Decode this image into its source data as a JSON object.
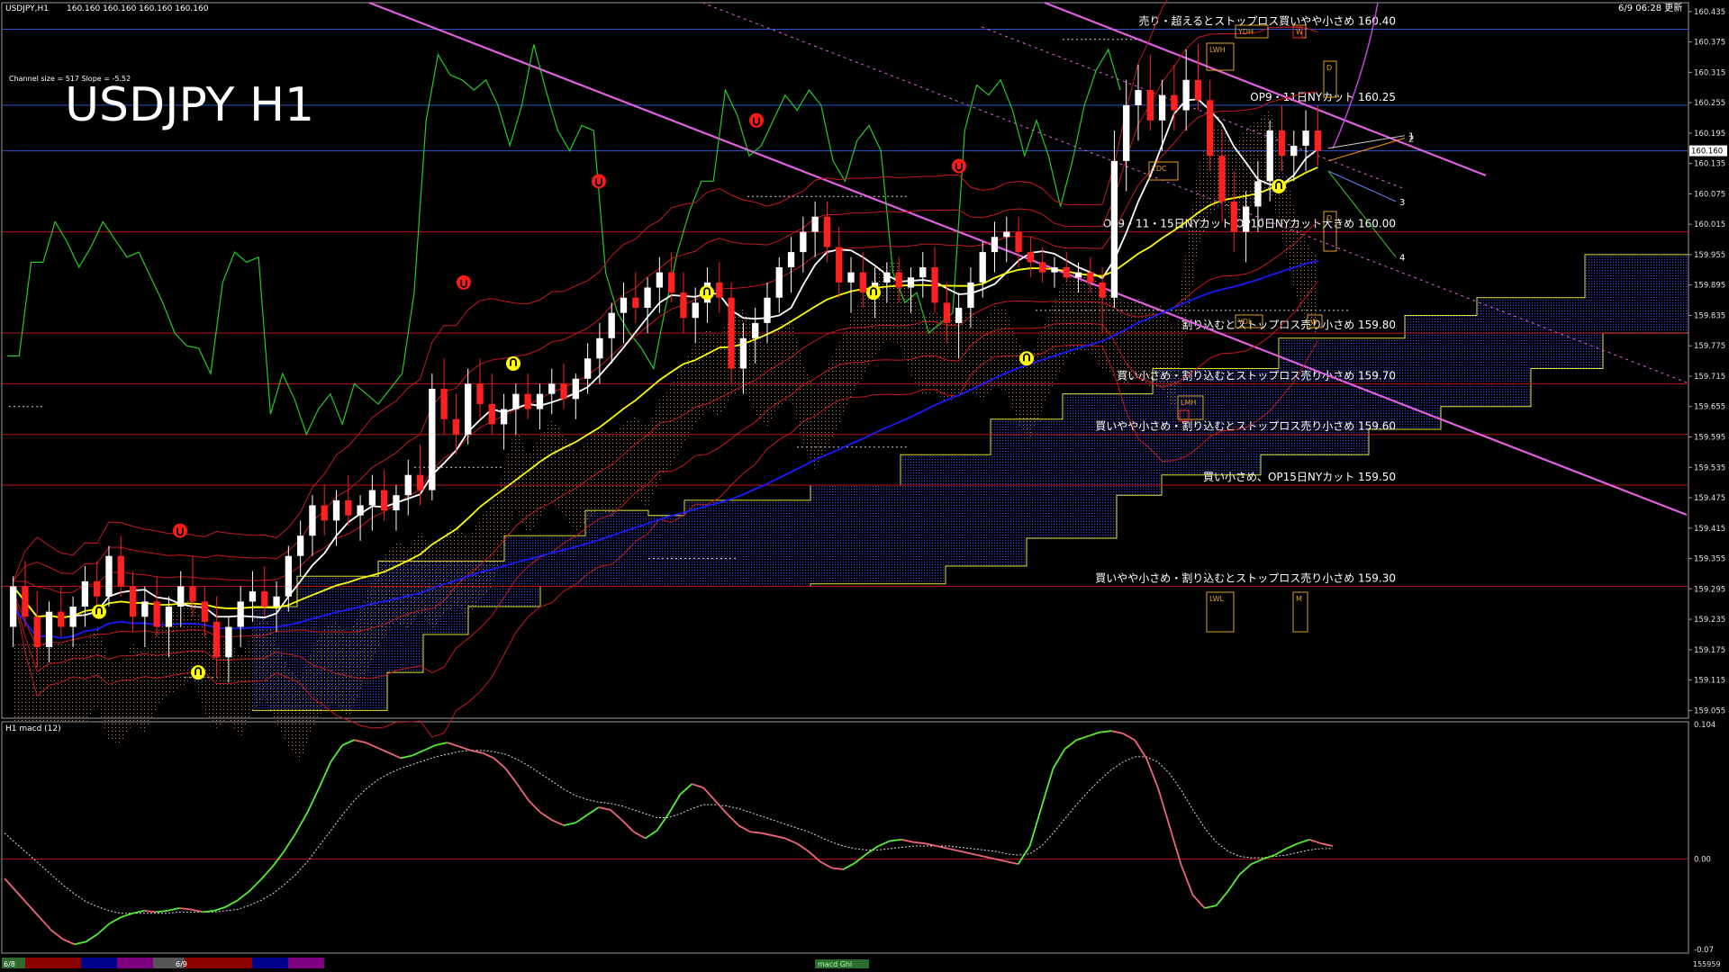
{
  "window": {
    "header_symbol": "USDJPY,H1",
    "header_ohlc": "160.160 160.160 160.160 160.160",
    "datetime": "6/9 06:28 更新"
  },
  "main_panel": {
    "title": "USDJPY H1",
    "channel_info": "Channel size = 517 Slope = -5.52",
    "price_tag": "160.160"
  },
  "macd_panel": {
    "title": "H1 macd (12)",
    "legend": "macd Ghl",
    "bottom_value": "155959"
  },
  "bottom_bar": {
    "date_labels": [
      "6/8",
      "6/9"
    ],
    "colors": [
      "#8b0000",
      "#00008b",
      "#7f007f",
      "#555555",
      "#8b0000",
      "#00008b",
      "#7f007f"
    ]
  },
  "order_levels": [
    {
      "price": 160.4,
      "label": "売り・超えるとストップロス買いやや小さめ 160.40",
      "line_color": "#2b55c9"
    },
    {
      "price": 160.25,
      "label": "OP9・11日NYカット 160.25",
      "line_color": "#2b55c9"
    },
    {
      "price": 160.16,
      "label": "",
      "line_color": "#2b55c9"
    },
    {
      "price": 160.0,
      "label": "OP9・11・15日NYカット/OP10日NYカット大きめ 160.00",
      "line_color": "#b81414"
    },
    {
      "price": 159.8,
      "label": "割り込むとストップロス売り小さめ 159.80",
      "line_color": "#b81414"
    },
    {
      "price": 159.7,
      "label": "買い小さめ・割り込むとストップロス売り小さめ 159.70",
      "line_color": "#b81414"
    },
    {
      "price": 159.6,
      "label": "買いやや小さめ・割り込むとストップロス売り小さめ 159.60",
      "line_color": "#b81414"
    },
    {
      "price": 159.5,
      "label": "買い小さめ、OP15日NYカット 159.50",
      "line_color": "#b81414"
    },
    {
      "price": 159.3,
      "label": "買いやや小さめ・割り込むとストップロス売り小さめ 159.30",
      "line_color": "#b81414"
    }
  ],
  "box_labels": [
    "YDH",
    "W",
    "LWH",
    "D",
    "YDC",
    "D",
    "YDL",
    "W",
    "LMH",
    "LWL",
    "M"
  ],
  "channel_numbers": [
    "1",
    "2",
    "3",
    "4"
  ],
  "colors": {
    "bull": "#ffffff",
    "bear": "#ff2020",
    "ma_fast": "#ffffff",
    "ma_mid": "#ffff00",
    "ma_slow": "#1a1aff",
    "chikou": "#22cc22",
    "channel": "#e060e0",
    "macd_up": "#55ee33",
    "macd_down": "#ee6677"
  },
  "chart_data": {
    "type": "candlestick",
    "symbol": "USDJPY",
    "timeframe": "H1",
    "y_axis_ticks": [
      "160.435",
      "160.375",
      "160.315",
      "160.255",
      "160.195",
      "160.135",
      "160.075",
      "160.015",
      "159.955",
      "159.895",
      "159.835",
      "159.775",
      "159.715",
      "159.655",
      "159.595",
      "159.535",
      "159.475",
      "159.415",
      "159.355",
      "159.295",
      "159.235",
      "159.175",
      "159.115",
      "159.055"
    ],
    "ylim": [
      159.045,
      160.44
    ],
    "candles_ohlc": [
      [
        159.22,
        159.32,
        159.18,
        159.3
      ],
      [
        159.3,
        159.35,
        159.22,
        159.24
      ],
      [
        159.24,
        159.29,
        159.14,
        159.18
      ],
      [
        159.18,
        159.27,
        159.15,
        159.25
      ],
      [
        159.25,
        159.3,
        159.2,
        159.22
      ],
      [
        159.22,
        159.28,
        159.18,
        159.26
      ],
      [
        159.26,
        159.34,
        159.22,
        159.31
      ],
      [
        159.31,
        159.35,
        159.26,
        159.28
      ],
      [
        159.28,
        159.38,
        159.26,
        159.36
      ],
      [
        159.36,
        159.4,
        159.28,
        159.3
      ],
      [
        159.3,
        159.33,
        159.21,
        159.24
      ],
      [
        159.24,
        159.3,
        159.18,
        159.27
      ],
      [
        159.27,
        159.32,
        159.2,
        159.22
      ],
      [
        159.22,
        159.28,
        159.16,
        159.26
      ],
      [
        159.26,
        159.33,
        159.22,
        159.3
      ],
      [
        159.3,
        159.36,
        159.24,
        159.27
      ],
      [
        159.27,
        159.3,
        159.2,
        159.23
      ],
      [
        159.23,
        159.28,
        159.12,
        159.16
      ],
      [
        159.16,
        159.24,
        159.11,
        159.22
      ],
      [
        159.22,
        159.3,
        159.18,
        159.27
      ],
      [
        159.27,
        159.33,
        159.23,
        159.29
      ],
      [
        159.29,
        159.34,
        159.24,
        159.26
      ],
      [
        159.26,
        159.31,
        159.21,
        159.28
      ],
      [
        159.28,
        159.38,
        159.25,
        159.36
      ],
      [
        159.36,
        159.43,
        159.32,
        159.4
      ],
      [
        159.4,
        159.48,
        159.36,
        159.46
      ],
      [
        159.46,
        159.5,
        159.4,
        159.43
      ],
      [
        159.43,
        159.49,
        159.38,
        159.47
      ],
      [
        159.47,
        159.52,
        159.42,
        159.44
      ],
      [
        159.44,
        159.48,
        159.39,
        159.46
      ],
      [
        159.46,
        159.52,
        159.41,
        159.49
      ],
      [
        159.49,
        159.53,
        159.43,
        159.45
      ],
      [
        159.45,
        159.5,
        159.41,
        159.48
      ],
      [
        159.48,
        159.55,
        159.44,
        159.52
      ],
      [
        159.52,
        159.58,
        159.46,
        159.49
      ],
      [
        159.49,
        159.72,
        159.47,
        159.69
      ],
      [
        159.69,
        159.75,
        159.6,
        159.63
      ],
      [
        159.63,
        159.68,
        159.56,
        159.6
      ],
      [
        159.6,
        159.73,
        159.58,
        159.7
      ],
      [
        159.7,
        159.75,
        159.63,
        159.66
      ],
      [
        159.66,
        159.72,
        159.6,
        159.62
      ],
      [
        159.62,
        159.68,
        159.57,
        159.65
      ],
      [
        159.65,
        159.7,
        159.6,
        159.68
      ],
      [
        159.68,
        159.72,
        159.63,
        159.65
      ],
      [
        159.65,
        159.7,
        159.61,
        159.68
      ],
      [
        159.68,
        159.73,
        159.64,
        159.7
      ],
      [
        159.7,
        159.74,
        159.65,
        159.67
      ],
      [
        159.67,
        159.72,
        159.63,
        159.71
      ],
      [
        159.71,
        159.78,
        159.68,
        159.75
      ],
      [
        159.75,
        159.82,
        159.7,
        159.79
      ],
      [
        159.79,
        159.86,
        159.74,
        159.84
      ],
      [
        159.84,
        159.9,
        159.78,
        159.87
      ],
      [
        159.87,
        159.92,
        159.82,
        159.85
      ],
      [
        159.85,
        159.91,
        159.8,
        159.89
      ],
      [
        159.89,
        159.95,
        159.84,
        159.92
      ],
      [
        159.92,
        159.96,
        159.86,
        159.88
      ],
      [
        159.88,
        159.92,
        159.8,
        159.83
      ],
      [
        159.83,
        159.89,
        159.78,
        159.86
      ],
      [
        159.86,
        159.93,
        159.82,
        159.9
      ],
      [
        159.9,
        159.94,
        159.84,
        159.87
      ],
      [
        159.87,
        159.9,
        159.7,
        159.73
      ],
      [
        159.73,
        159.82,
        159.68,
        159.79
      ],
      [
        159.79,
        159.85,
        159.74,
        159.82
      ],
      [
        159.82,
        159.9,
        159.78,
        159.87
      ],
      [
        159.87,
        159.95,
        159.84,
        159.93
      ],
      [
        159.93,
        159.99,
        159.88,
        159.96
      ],
      [
        159.96,
        160.03,
        159.92,
        160.0
      ],
      [
        160.0,
        160.06,
        159.95,
        160.03
      ],
      [
        160.03,
        160.06,
        159.94,
        159.97
      ],
      [
        159.97,
        160.01,
        159.87,
        159.9
      ],
      [
        159.9,
        159.95,
        159.84,
        159.92
      ],
      [
        159.92,
        159.96,
        159.85,
        159.88
      ],
      [
        159.88,
        159.93,
        159.83,
        159.9
      ],
      [
        159.9,
        159.94,
        159.86,
        159.92
      ],
      [
        159.92,
        159.95,
        159.86,
        159.89
      ],
      [
        159.89,
        159.93,
        159.84,
        159.91
      ],
      [
        159.91,
        159.96,
        159.87,
        159.93
      ],
      [
        159.93,
        159.97,
        159.84,
        159.86
      ],
      [
        159.86,
        159.9,
        159.78,
        159.82
      ],
      [
        159.82,
        159.88,
        159.75,
        159.85
      ],
      [
        159.85,
        159.93,
        159.81,
        159.9
      ],
      [
        159.9,
        159.98,
        159.87,
        159.96
      ],
      [
        159.96,
        160.02,
        159.92,
        159.99
      ],
      [
        159.99,
        160.03,
        159.94,
        160.0
      ],
      [
        160.0,
        160.03,
        159.93,
        159.96
      ],
      [
        159.96,
        159.99,
        159.91,
        159.94
      ],
      [
        159.94,
        159.97,
        159.9,
        159.92
      ],
      [
        159.92,
        159.95,
        159.89,
        159.93
      ],
      [
        159.93,
        159.96,
        159.9,
        159.91
      ],
      [
        159.91,
        159.94,
        159.88,
        159.92
      ],
      [
        159.92,
        159.95,
        159.88,
        159.9
      ],
      [
        159.9,
        159.93,
        159.8,
        159.87
      ],
      [
        159.87,
        160.2,
        159.85,
        160.14
      ],
      [
        160.14,
        160.3,
        160.08,
        160.25
      ],
      [
        160.25,
        160.33,
        160.18,
        160.28
      ],
      [
        160.28,
        160.35,
        160.2,
        160.22
      ],
      [
        160.22,
        160.3,
        160.16,
        160.27
      ],
      [
        160.27,
        160.33,
        160.2,
        160.24
      ],
      [
        160.24,
        160.36,
        160.2,
        160.3
      ],
      [
        160.3,
        160.37,
        160.24,
        160.26
      ],
      [
        160.26,
        160.3,
        160.12,
        160.15
      ],
      [
        160.15,
        160.2,
        160.02,
        160.06
      ],
      [
        160.06,
        160.12,
        159.96,
        160.0
      ],
      [
        160.0,
        160.08,
        159.94,
        160.05
      ],
      [
        160.05,
        160.14,
        160.0,
        160.1
      ],
      [
        160.1,
        160.22,
        160.06,
        160.2
      ],
      [
        160.2,
        160.25,
        160.12,
        160.15
      ],
      [
        160.15,
        160.2,
        160.1,
        160.17
      ],
      [
        160.17,
        160.24,
        160.12,
        160.2
      ],
      [
        160.2,
        160.25,
        160.13,
        160.16
      ]
    ],
    "overlays": [
      "Ichimoku cloud",
      "moving averages (white / yellow / blue)",
      "Bollinger bands",
      "descending channel"
    ],
    "macd": {
      "ylim": [
        -0.07,
        0.104
      ],
      "ticks": [
        "0.104",
        "0.00",
        "-0.07"
      ],
      "values": [
        -0.015,
        -0.025,
        -0.035,
        -0.045,
        -0.055,
        -0.062,
        -0.066,
        -0.064,
        -0.058,
        -0.05,
        -0.045,
        -0.042,
        -0.04,
        -0.041,
        -0.04,
        -0.038,
        -0.039,
        -0.041,
        -0.04,
        -0.037,
        -0.032,
        -0.025,
        -0.016,
        -0.006,
        0.006,
        0.02,
        0.036,
        0.055,
        0.075,
        0.088,
        0.092,
        0.09,
        0.086,
        0.082,
        0.078,
        0.08,
        0.084,
        0.088,
        0.09,
        0.087,
        0.084,
        0.082,
        0.078,
        0.07,
        0.058,
        0.045,
        0.036,
        0.03,
        0.026,
        0.028,
        0.034,
        0.04,
        0.038,
        0.03,
        0.021,
        0.016,
        0.022,
        0.035,
        0.05,
        0.058,
        0.055,
        0.045,
        0.035,
        0.026,
        0.021,
        0.02,
        0.018,
        0.016,
        0.012,
        0.006,
        -0.002,
        -0.007,
        -0.008,
        -0.003,
        0.004,
        0.01,
        0.014,
        0.015,
        0.013,
        0.012,
        0.01,
        0.008,
        0.006,
        0.004,
        0.002,
        0.0,
        -0.002,
        -0.004,
        0.01,
        0.04,
        0.07,
        0.085,
        0.092,
        0.095,
        0.098,
        0.099,
        0.097,
        0.092,
        0.078,
        0.055,
        0.025,
        -0.005,
        -0.028,
        -0.038,
        -0.036,
        -0.025,
        -0.012,
        -0.004,
        0.0,
        0.003,
        0.008,
        0.012,
        0.015,
        0.012,
        0.01
      ],
      "signal": [
        0.02,
        0.012,
        0.004,
        -0.004,
        -0.012,
        -0.02,
        -0.027,
        -0.033,
        -0.037,
        -0.04,
        -0.042,
        -0.042,
        -0.042,
        -0.042,
        -0.042,
        -0.041,
        -0.041,
        -0.041,
        -0.041,
        -0.04,
        -0.039,
        -0.036,
        -0.032,
        -0.027,
        -0.02,
        -0.012,
        -0.002,
        0.01,
        0.022,
        0.034,
        0.045,
        0.054,
        0.061,
        0.066,
        0.07,
        0.073,
        0.076,
        0.079,
        0.081,
        0.083,
        0.084,
        0.084,
        0.083,
        0.081,
        0.077,
        0.072,
        0.066,
        0.06,
        0.054,
        0.049,
        0.046,
        0.044,
        0.043,
        0.041,
        0.038,
        0.035,
        0.032,
        0.032,
        0.035,
        0.039,
        0.042,
        0.042,
        0.041,
        0.039,
        0.036,
        0.033,
        0.03,
        0.027,
        0.024,
        0.021,
        0.017,
        0.013,
        0.01,
        0.008,
        0.007,
        0.007,
        0.008,
        0.009,
        0.01,
        0.01,
        0.01,
        0.01,
        0.009,
        0.008,
        0.007,
        0.006,
        0.004,
        0.003,
        0.004,
        0.01,
        0.02,
        0.031,
        0.042,
        0.052,
        0.061,
        0.069,
        0.075,
        0.079,
        0.079,
        0.075,
        0.066,
        0.053,
        0.038,
        0.024,
        0.013,
        0.006,
        0.002,
        0.001,
        0.001,
        0.002,
        0.003,
        0.005,
        0.007,
        0.008,
        0.008
      ]
    }
  }
}
